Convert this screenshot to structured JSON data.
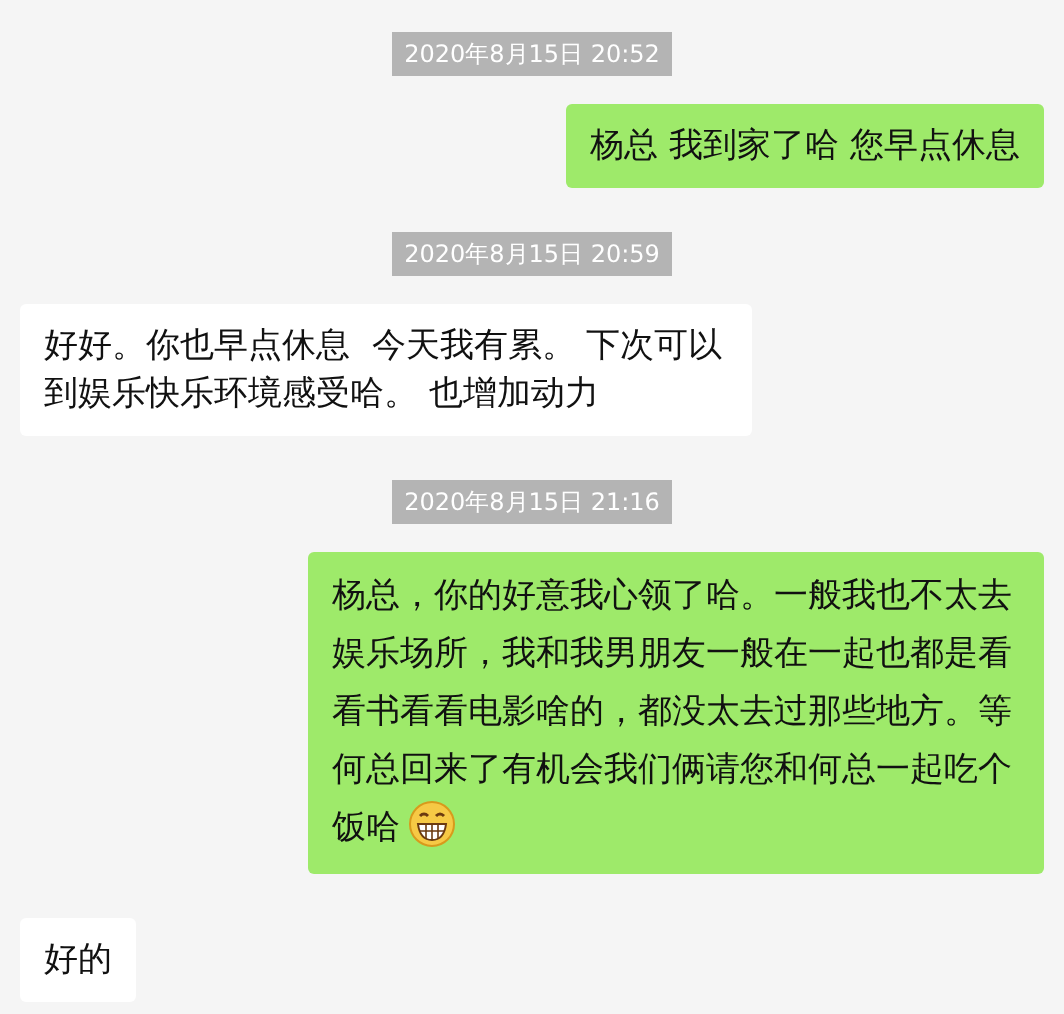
{
  "messages": [
    {
      "kind": "time",
      "text": "2020年8月15日 20:52"
    },
    {
      "kind": "message",
      "outgoing": true,
      "text": "杨总 我到家了哈 您早点休息"
    },
    {
      "kind": "time",
      "text": "2020年8月15日 20:59"
    },
    {
      "kind": "message",
      "outgoing": false,
      "text": "好好。你也早点休息  今天我有累。 下次可以到娱乐快乐环境感受哈。 也增加动力"
    },
    {
      "kind": "time",
      "text": "2020年8月15日 21:16"
    },
    {
      "kind": "message",
      "outgoing": true,
      "emoji": true,
      "text": "杨总，你的好意我心领了哈。一般我也不太去娱乐场所，我和我男朋友一般在一起也都是看看书看看电影啥的，都没太去过那些地方。等何总回来了有机会我们俩请您和何总一起吃个饭哈"
    },
    {
      "kind": "message",
      "outgoing": false,
      "text": "好的"
    }
  ]
}
